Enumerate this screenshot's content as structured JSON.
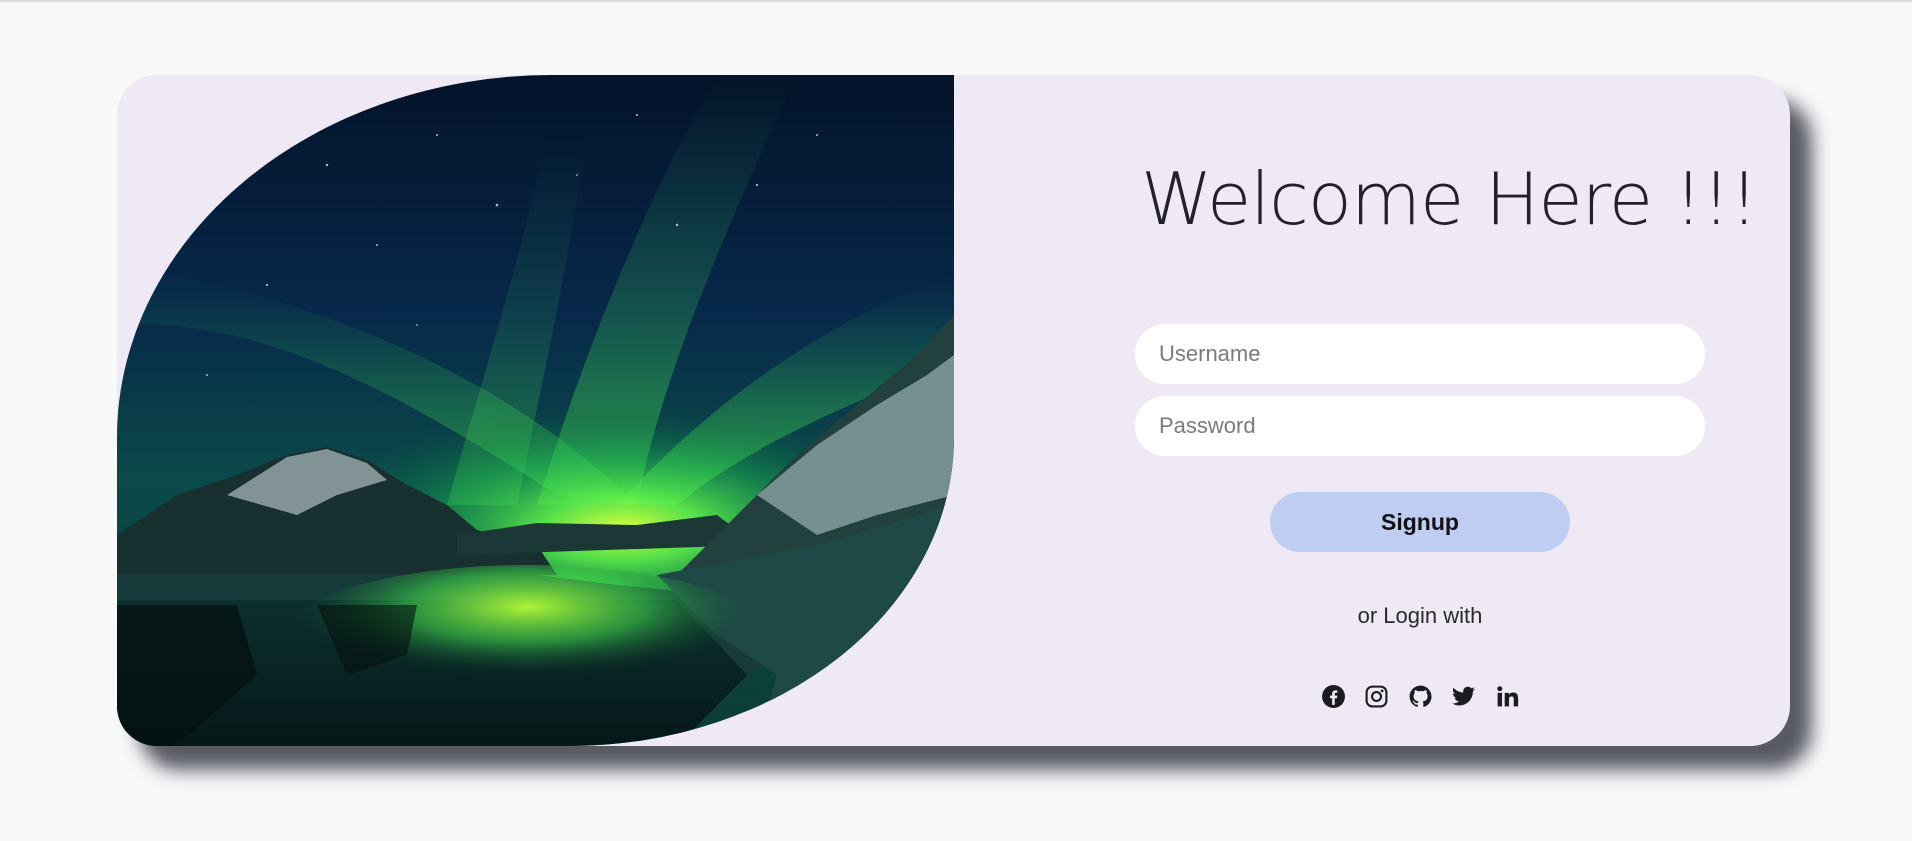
{
  "login": {
    "title": "Welcome Here !!!",
    "username_placeholder": "Username",
    "password_placeholder": "Password",
    "signup_label": "Signup",
    "alt_login_text": "or Login with"
  },
  "socials": [
    {
      "icon": "facebook-icon"
    },
    {
      "icon": "instagram-icon"
    },
    {
      "icon": "github-icon"
    },
    {
      "icon": "twitter-icon"
    },
    {
      "icon": "linkedin-icon"
    }
  ],
  "colors": {
    "page_background": "#f7f8fa",
    "card_background": "#efe9f6",
    "button_background": "#bfcdf2",
    "text_dark": "#24212c",
    "aurora_green": "#39e05a"
  }
}
